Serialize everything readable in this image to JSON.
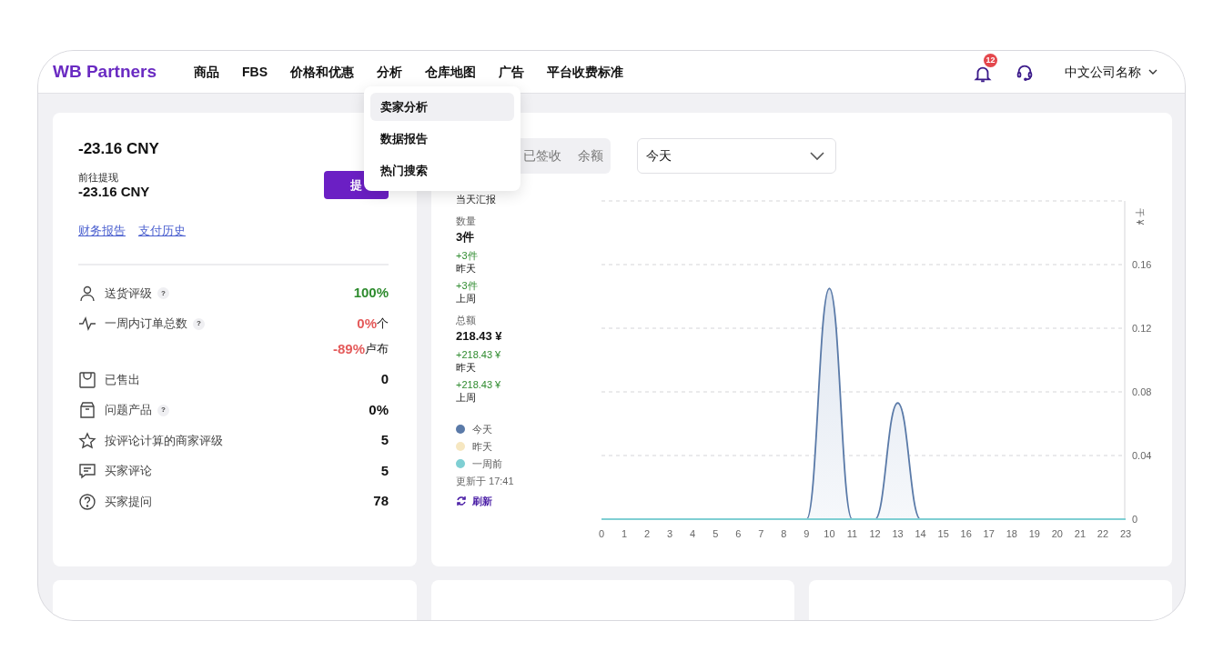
{
  "header": {
    "logo": "WB Partners",
    "nav": [
      {
        "label": "商品"
      },
      {
        "label": "FBS"
      },
      {
        "label": "价格和优惠"
      },
      {
        "label": "分析",
        "menu": [
          {
            "label": "卖家分析",
            "selected": true
          },
          {
            "label": "数据报告",
            "selected": false
          },
          {
            "label": "热门搜索",
            "selected": false
          }
        ]
      },
      {
        "label": "仓库地图"
      },
      {
        "label": "广告"
      },
      {
        "label": "平台收费标准"
      }
    ],
    "notifications": "12",
    "company": "中文公司名称"
  },
  "balance": {
    "amount": "-23.16 CNY",
    "withdraw_label": "前往提现",
    "withdraw_amount": "-23.16 CNY",
    "withdraw_button": "提",
    "links": [
      "财务报告",
      "支付历史"
    ],
    "stats": [
      {
        "kind": "user",
        "label": "送货评级",
        "help": "?",
        "values": [
          {
            "value": "100%",
            "color": "#2e8b2e"
          }
        ]
      },
      {
        "kind": "pulse",
        "label": "一周内订单总数",
        "help": "?",
        "values": [
          {
            "value": "0%",
            "unit": "个",
            "color": "#e45a5a"
          },
          {
            "value": "-89%",
            "unit": "卢布",
            "color": "#e45a5a"
          }
        ]
      },
      {
        "kind": "bag",
        "label": "已售出",
        "values": [
          {
            "value": "0"
          }
        ]
      },
      {
        "kind": "box",
        "label": "问题产品",
        "help": "?",
        "values": [
          {
            "value": "0%"
          }
        ]
      },
      {
        "kind": "star",
        "label": "按评论计算的商家评级",
        "values": [
          {
            "value": "5"
          }
        ]
      },
      {
        "kind": "chat",
        "label": "买家评论",
        "values": [
          {
            "value": "5"
          }
        ]
      },
      {
        "kind": "question",
        "label": "买家提问",
        "values": [
          {
            "value": "78"
          }
        ]
      }
    ]
  },
  "sales": {
    "segments": [
      {
        "label": "已签收",
        "selected": false
      },
      {
        "label": "余额",
        "selected": false
      }
    ],
    "period": "今天",
    "report_title": "当天汇报",
    "metrics": [
      {
        "label": "数量",
        "value": "3件",
        "changes": [
          {
            "delta": "+3件",
            "label": "昨天"
          },
          {
            "delta": "+3件",
            "label": "上周"
          }
        ]
      },
      {
        "label": "总额",
        "value": "218.43 ¥",
        "changes": [
          {
            "delta": "+218.43 ¥",
            "label": "昨天"
          },
          {
            "delta": "+218.43 ¥",
            "label": "上周"
          }
        ]
      }
    ],
    "updated": "更新于 17:41",
    "refresh": "刷新",
    "chart_data": {
      "type": "line",
      "ylabel": "千 ¥",
      "grid": true,
      "x": [
        0,
        1,
        2,
        3,
        4,
        5,
        6,
        7,
        8,
        9,
        10,
        11,
        12,
        13,
        14,
        15,
        16,
        17,
        18,
        19,
        20,
        21,
        22,
        23
      ],
      "xlim": [
        0,
        23
      ],
      "ylim": [
        0,
        0.2
      ],
      "yticks": [
        0,
        0.04,
        0.08,
        0.12,
        0.16
      ],
      "xticks": [
        0,
        1,
        2,
        3,
        4,
        5,
        6,
        7,
        8,
        9,
        10,
        11,
        12,
        13,
        14,
        15,
        16,
        17,
        18,
        19,
        20,
        21,
        22,
        23
      ],
      "series": [
        {
          "name": "今天",
          "color": "#5a7aa8",
          "values": [
            0,
            0,
            0,
            0,
            0,
            0,
            0,
            0,
            0,
            0,
            0.145,
            0,
            0,
            0.073,
            0,
            0,
            0,
            0,
            0,
            0,
            0,
            0,
            0,
            0
          ]
        },
        {
          "name": "昨天",
          "color": "#f6e7c1",
          "values": [
            null,
            null,
            null,
            null,
            null,
            null,
            null,
            null,
            null,
            null,
            null,
            null,
            null,
            null,
            null,
            null,
            null,
            null,
            null,
            null,
            null,
            null,
            null,
            null
          ]
        },
        {
          "name": "一周前",
          "color": "#7fcfd3",
          "values": [
            0,
            0,
            0,
            0,
            0,
            0,
            0,
            0,
            0,
            0,
            0,
            0,
            0,
            0,
            0,
            0,
            0,
            0,
            0,
            0,
            0,
            0,
            0,
            0
          ]
        }
      ]
    }
  }
}
